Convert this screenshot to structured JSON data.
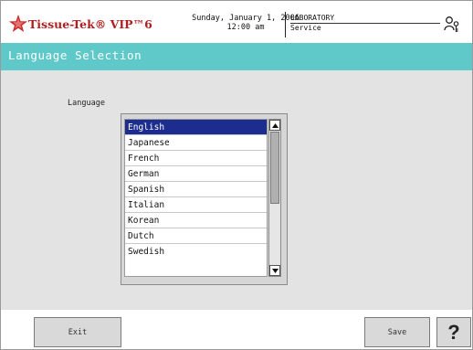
{
  "header": {
    "brand": "Tissue-Tek® VIP™6",
    "date": "Sunday, January 1, 2006",
    "time": "12:00 am",
    "location": "LABORATORY",
    "mode": "Service"
  },
  "page": {
    "title": "Language Selection"
  },
  "language": {
    "label": "Language",
    "selected": "English",
    "options": [
      "English",
      "Japanese",
      "French",
      "German",
      "Spanish",
      "Italian",
      "Korean",
      "Dutch",
      "Swedish"
    ]
  },
  "footer": {
    "exit_label": "Exit",
    "save_label": "Save",
    "help_label": "?"
  },
  "colors": {
    "title_bar": "#5fc8c8",
    "selection": "#1c2d8f",
    "brand": "#b02020"
  }
}
